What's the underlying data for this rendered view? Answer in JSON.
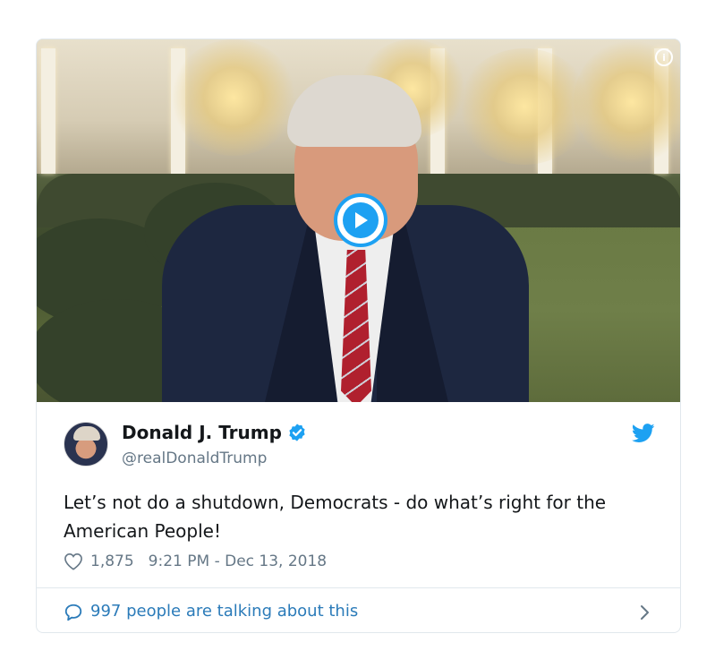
{
  "tweet": {
    "author_name": "Donald J. Trump",
    "handle": "@realDonaldTrump",
    "text": "Let’s not do a shutdown, Democrats - do what’s right for the American People!",
    "likes": "1,875",
    "timestamp": "9:21 PM - Dec 13, 2018",
    "info_glyph": "i",
    "conversation_label": "997 people are talking about this"
  },
  "colors": {
    "accent": "#1da1f2",
    "link": "#2b7bb9",
    "muted": "#657786",
    "text": "#14171a",
    "border": "#e1e8ed"
  },
  "icons": [
    "play-icon",
    "info-icon",
    "verified-badge-icon",
    "twitter-bird-icon",
    "heart-icon",
    "speech-bubble-icon",
    "chevron-right-icon"
  ]
}
